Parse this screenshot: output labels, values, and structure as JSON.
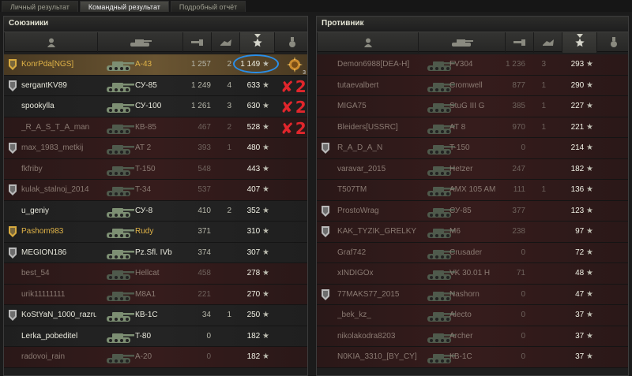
{
  "tabs": [
    "Личный результат",
    "Командный результат",
    "Подробный отчёт"
  ],
  "active_tab": 1,
  "allies": {
    "title": "Союзники",
    "rows": [
      {
        "badge": "gold",
        "name": "KonrPda[NGS]",
        "vehicle": "A-43",
        "dmg": "1 257",
        "kills": "2",
        "score": "1 149",
        "state": "me",
        "gold": true,
        "annot": "",
        "medal": "3"
      },
      {
        "badge": "silver",
        "name": "sergantKV89",
        "vehicle": "СУ-85",
        "dmg": "1 249",
        "kills": "4",
        "score": "633",
        "state": "alive",
        "gold": false,
        "annot": "2",
        "medal": ""
      },
      {
        "badge": "",
        "name": "spookylla",
        "vehicle": "СУ-100",
        "dmg": "1 261",
        "kills": "3",
        "score": "630",
        "state": "alive",
        "gold": false,
        "annot": "2",
        "medal": ""
      },
      {
        "badge": "",
        "name": "_R_A_S_T_A_man",
        "vehicle": "КВ-85",
        "dmg": "467",
        "kills": "2",
        "score": "528",
        "state": "dead",
        "gold": false,
        "annot": "2",
        "medal": ""
      },
      {
        "badge": "silver",
        "name": "max_1983_metkij",
        "vehicle": "AT 2",
        "dmg": "393",
        "kills": "1",
        "score": "480",
        "state": "dead",
        "gold": false,
        "annot": "",
        "medal": ""
      },
      {
        "badge": "",
        "name": "fkfriby",
        "vehicle": "T-150",
        "dmg": "548",
        "kills": "",
        "score": "443",
        "state": "dead",
        "gold": false,
        "annot": "",
        "medal": ""
      },
      {
        "badge": "silver",
        "name": "kulak_stalnoj_2014",
        "vehicle": "T-34",
        "dmg": "537",
        "kills": "",
        "score": "407",
        "state": "dead",
        "gold": false,
        "annot": "",
        "medal": ""
      },
      {
        "badge": "",
        "name": "u_geniy",
        "vehicle": "СУ-8",
        "dmg": "410",
        "kills": "2",
        "score": "352",
        "state": "alive",
        "gold": false,
        "annot": "",
        "medal": ""
      },
      {
        "badge": "gold",
        "name": "Pashom983",
        "vehicle": "Rudy",
        "dmg": "371",
        "kills": "",
        "score": "310",
        "state": "alive",
        "gold": true,
        "annot": "",
        "medal": ""
      },
      {
        "badge": "silver",
        "name": "MEGION186",
        "vehicle": "Pz.Sfl. IVb",
        "dmg": "374",
        "kills": "",
        "score": "307",
        "state": "alive",
        "gold": false,
        "annot": "",
        "medal": ""
      },
      {
        "badge": "",
        "name": "best_54",
        "vehicle": "Hellcat",
        "dmg": "458",
        "kills": "",
        "score": "278",
        "state": "dead",
        "gold": false,
        "annot": "",
        "medal": ""
      },
      {
        "badge": "",
        "name": "urik11111111",
        "vehicle": "M8A1",
        "dmg": "221",
        "kills": "",
        "score": "270",
        "state": "dead",
        "gold": false,
        "annot": "",
        "medal": ""
      },
      {
        "badge": "silver",
        "name": "KoStYaN_1000_razru..",
        "vehicle": "КВ-1С",
        "dmg": "34",
        "kills": "1",
        "score": "250",
        "state": "alive",
        "gold": false,
        "annot": "",
        "medal": ""
      },
      {
        "badge": "",
        "name": "Lerka_pobeditel",
        "vehicle": "T-80",
        "dmg": "0",
        "kills": "",
        "score": "182",
        "state": "alive",
        "gold": false,
        "annot": "",
        "medal": ""
      },
      {
        "badge": "",
        "name": "radovoi_rain",
        "vehicle": "A-20",
        "dmg": "0",
        "kills": "",
        "score": "182",
        "state": "dead",
        "gold": false,
        "annot": "",
        "medal": ""
      }
    ]
  },
  "enemies": {
    "title": "Противник",
    "rows": [
      {
        "badge": "",
        "name": "Demon6988[DEA-H]",
        "vehicle": "FV304",
        "dmg": "1 236",
        "kills": "3",
        "score": "293",
        "state": "dead"
      },
      {
        "badge": "",
        "name": "tutaevalbert",
        "vehicle": "Cromwell",
        "dmg": "877",
        "kills": "1",
        "score": "290",
        "state": "dead"
      },
      {
        "badge": "",
        "name": "MIGA75",
        "vehicle": "StuG III G",
        "dmg": "385",
        "kills": "1",
        "score": "227",
        "state": "dead"
      },
      {
        "badge": "",
        "name": "Bleiders[USSRC]",
        "vehicle": "AT 8",
        "dmg": "970",
        "kills": "1",
        "score": "221",
        "state": "dead"
      },
      {
        "badge": "silver",
        "name": "R_A_D_A_N",
        "vehicle": "T-150",
        "dmg": "0",
        "kills": "",
        "score": "214",
        "state": "dead"
      },
      {
        "badge": "",
        "name": "varavar_2015",
        "vehicle": "Hetzer",
        "dmg": "247",
        "kills": "",
        "score": "182",
        "state": "dead"
      },
      {
        "badge": "",
        "name": "T507TM",
        "vehicle": "AMX 105 AM",
        "dmg": "111",
        "kills": "1",
        "score": "136",
        "state": "dead"
      },
      {
        "badge": "silver",
        "name": "ProstoWrag",
        "vehicle": "СУ-85",
        "dmg": "377",
        "kills": "",
        "score": "123",
        "state": "dead"
      },
      {
        "badge": "silver",
        "name": "KAK_TYZIK_GRELKY",
        "vehicle": "M6",
        "dmg": "238",
        "kills": "",
        "score": "97",
        "state": "dead"
      },
      {
        "badge": "",
        "name": "Graf742",
        "vehicle": "Crusader",
        "dmg": "0",
        "kills": "",
        "score": "72",
        "state": "dead"
      },
      {
        "badge": "",
        "name": "xINDIGOx",
        "vehicle": "VK 30.01 H",
        "dmg": "71",
        "kills": "",
        "score": "48",
        "state": "dead"
      },
      {
        "badge": "silver",
        "name": "77MAKS77_2015",
        "vehicle": "Nashorn",
        "dmg": "0",
        "kills": "",
        "score": "47",
        "state": "dead"
      },
      {
        "badge": "",
        "name": "_bek_kz_",
        "vehicle": "Alecto",
        "dmg": "0",
        "kills": "",
        "score": "37",
        "state": "dead"
      },
      {
        "badge": "",
        "name": "nikolakodra8203",
        "vehicle": "Archer",
        "dmg": "0",
        "kills": "",
        "score": "37",
        "state": "dead"
      },
      {
        "badge": "",
        "name": "N0KIA_3310_[BY_CY]",
        "vehicle": "КВ-1С",
        "dmg": "0",
        "kills": "",
        "score": "37",
        "state": "dead"
      }
    ]
  },
  "icons": {
    "score": "star-icon",
    "sort": "chevron-down-icon",
    "medal": "medal-icon"
  },
  "colors": {
    "annotation_red": "#e1262c",
    "highlight_blue": "#2a8ee8",
    "gold_text": "#e0b347",
    "dead_row": "#361c1c"
  }
}
